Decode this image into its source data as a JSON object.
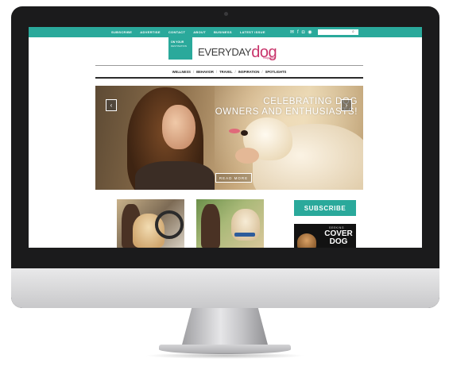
{
  "top_nav": {
    "items": [
      "SUBSCRIBE",
      "ADVERTISE",
      "CONTACT",
      "ABOUT",
      "BUSINESS",
      "LATEST ISSUE"
    ],
    "social_icons": [
      "mail-icon",
      "facebook-icon",
      "instagram-icon",
      "pinterest-icon"
    ],
    "search_placeholder": ""
  },
  "promo": {
    "line1": "ON YOUR",
    "line2": "DESTINATION"
  },
  "logo": {
    "every": "EVERYDAY",
    "dog": "dog",
    "tagline": "magazine"
  },
  "main_nav": {
    "items": [
      "WELLNESS",
      "BEHAVIOR",
      "TRAVEL",
      "INSPIRATION",
      "SPOTLIGHTS"
    ],
    "separator": "/"
  },
  "hero": {
    "title_line1": "CELEBRATING DOG",
    "title_line2": "OWNERS AND ENTHUSIASTS!",
    "read_more": "READ MORE",
    "prev_glyph": "‹",
    "next_glyph": "›"
  },
  "sidebar": {
    "subscribe_label": "SUBSCRIBE",
    "cover_seeking": "SEEKING",
    "cover_line1": "COVER",
    "cover_line2": "DOG"
  },
  "colors": {
    "accent": "#2aa99b",
    "brand_pink": "#c8346b",
    "bezel": "#1b1b1c"
  }
}
